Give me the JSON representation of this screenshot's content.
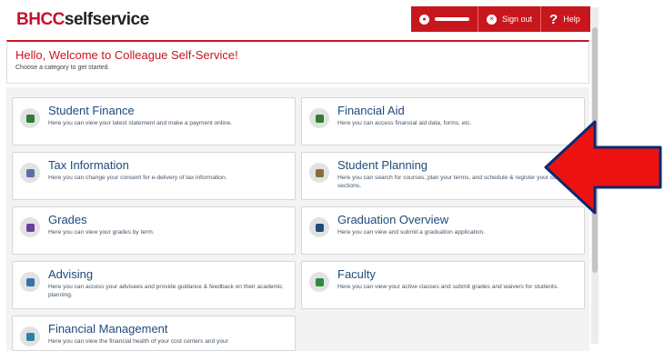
{
  "brand": {
    "part1": "BHCC",
    "part2": "selfservice"
  },
  "header": {
    "sign_out": "Sign out",
    "help": "Help",
    "help_glyph": "?"
  },
  "welcome": {
    "title": "Hello, Welcome to Colleague Self-Service!",
    "subtitle": "Choose a category to get started."
  },
  "cards": [
    {
      "title": "Student Finance",
      "desc": "Here you can view your latest statement and make a payment online.",
      "icon": "dollar-icon",
      "color": "#2e7d32"
    },
    {
      "title": "Financial Aid",
      "desc": "Here you can access financial aid data, forms, etc.",
      "icon": "money-icon",
      "color": "#2e7d32"
    },
    {
      "title": "Tax Information",
      "desc": "Here you can change your consent for e-delivery of tax information.",
      "icon": "tax-form-icon",
      "color": "#5a6fa8"
    },
    {
      "title": "Student Planning",
      "desc": "Here you can search for courses, plan your terms, and schedule & register your course sections.",
      "icon": "planning-icon",
      "color": "#8a6d3b"
    },
    {
      "title": "Grades",
      "desc": "Here you can view your grades by term.",
      "icon": "grades-icon",
      "color": "#6a3fa0"
    },
    {
      "title": "Graduation Overview",
      "desc": "Here you can view and submit a graduation application.",
      "icon": "graduation-cap-icon",
      "color": "#1f4a7c"
    },
    {
      "title": "Advising",
      "desc": "Here you can access your advisees and provide guidance & feedback on their academic planning.",
      "icon": "advising-icon",
      "color": "#3a6fb0"
    },
    {
      "title": "Faculty",
      "desc": "Here you can view your active classes and submit grades and waivers for students.",
      "icon": "faculty-icon",
      "color": "#2e8a3e"
    },
    {
      "title": "Financial Management",
      "desc": "Here you can view the financial health of your cost centers and your",
      "icon": "pie-chart-icon",
      "color": "#2f7fa8"
    }
  ],
  "annotation": {
    "icon": "red-arrow-icon",
    "color": "#ee1111",
    "outline": "#0a2a6e"
  }
}
